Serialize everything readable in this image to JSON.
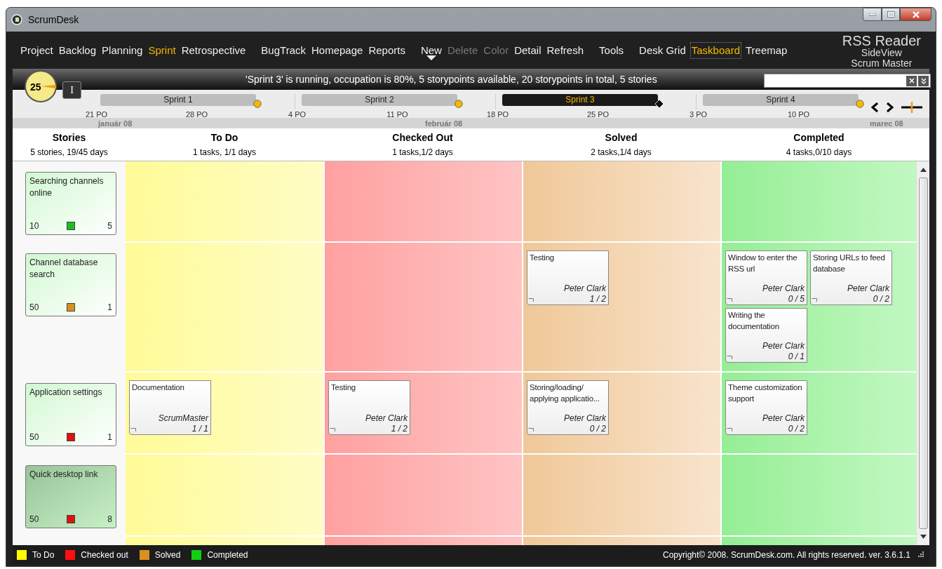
{
  "window": {
    "title": "ScrumDesk"
  },
  "menu": [
    {
      "items": [
        {
          "label": "Project",
          "selected": false,
          "disabled": false
        },
        {
          "label": "Backlog",
          "selected": false,
          "disabled": false
        },
        {
          "label": "Planning",
          "selected": false,
          "disabled": false
        },
        {
          "label": "Sprint",
          "selected": true,
          "disabled": false
        },
        {
          "label": "Retrospective",
          "selected": false,
          "disabled": false
        }
      ]
    },
    {
      "items": [
        {
          "label": "BugTrack",
          "selected": false,
          "disabled": false
        },
        {
          "label": "Homepage",
          "selected": false,
          "disabled": false
        },
        {
          "label": "Reports",
          "selected": false,
          "disabled": false
        }
      ]
    },
    {
      "items": [
        {
          "label": "New",
          "selected": false,
          "disabled": false,
          "has_menu": true
        },
        {
          "label": "Delete",
          "selected": false,
          "disabled": true
        },
        {
          "label": "Color",
          "selected": false,
          "disabled": true
        },
        {
          "label": "Detail",
          "selected": false,
          "disabled": false
        },
        {
          "label": "Refresh",
          "selected": false,
          "disabled": false
        }
      ]
    },
    {
      "items": [
        {
          "label": "Tools",
          "selected": false,
          "disabled": false
        }
      ]
    },
    {
      "items": [
        {
          "label": "Desk Grid",
          "selected": false,
          "disabled": false
        },
        {
          "label": "Taskboard",
          "selected": true,
          "disabled": false
        },
        {
          "label": "Treemap",
          "selected": false,
          "disabled": false
        }
      ]
    }
  ],
  "project": {
    "title": "RSS Reader",
    "lines": [
      "SideView",
      "Scrum Master"
    ]
  },
  "status": {
    "clock": "25",
    "button": "I",
    "message": "'Sprint 3' is running, occupation is 80%, 5 storypoints available, 20 storypoints in total,  5 stories"
  },
  "timeline": {
    "sprints": [
      {
        "label": "Sprint 1",
        "selected": false
      },
      {
        "label": "Sprint 2",
        "selected": false
      },
      {
        "label": "Sprint 3",
        "selected": true
      },
      {
        "label": "Sprint 4",
        "selected": false
      }
    ],
    "dates": [
      "21 PO",
      "28 PO",
      "4 PO",
      "11 PO",
      "18 PO",
      "25 PO",
      "3 PO",
      "10 PO"
    ],
    "months": [
      "január 08",
      "február 08",
      "marec 08"
    ]
  },
  "columns": [
    {
      "kind": "stories",
      "title": "Stories",
      "summary": "5 stories, 19/45 days"
    },
    {
      "kind": "todo",
      "title": "To Do",
      "summary": "1 tasks, 1/1 days"
    },
    {
      "kind": "checked_out",
      "title": "Checked Out",
      "summary": "1 tasks,1/2 days"
    },
    {
      "kind": "solved",
      "title": "Solved",
      "summary": "2 tasks,1/4 days"
    },
    {
      "kind": "completed",
      "title": "Completed",
      "summary": "4 tasks,0/10 days"
    }
  ],
  "stories": [
    {
      "title": "Searching channels online",
      "points": "10",
      "color": "#22bb22",
      "count": "5",
      "selected": false
    },
    {
      "title": "Channel database search",
      "points": "50",
      "color": "#d9901f",
      "count": "1",
      "selected": false,
      "tasks": {
        "solved": [
          {
            "title": "Testing",
            "owner": "Peter Clark",
            "progress": "1 / 2"
          }
        ],
        "completed": [
          {
            "title": "Window to enter the RSS url",
            "owner": "Peter Clark",
            "progress": "0 / 5"
          },
          {
            "title": "Storing URLs to feed database",
            "owner": "Peter Clark",
            "progress": "0 / 2"
          },
          {
            "title": "Writing the documentation",
            "owner": "Peter Clark",
            "progress": "0 / 1"
          }
        ]
      }
    },
    {
      "title": "Application settings",
      "points": "50",
      "color": "#e01010",
      "count": "1",
      "selected": false,
      "tasks": {
        "todo": [
          {
            "title": "Documentation",
            "owner": "ScrumMaster",
            "progress": "1 / 1"
          }
        ],
        "checked_out": [
          {
            "title": "Testing",
            "owner": "Peter Clark",
            "progress": "1 / 2"
          }
        ],
        "solved": [
          {
            "title": "Storing/loading/ applying applicatio...",
            "owner": "Peter Clark",
            "progress": "0 / 2"
          }
        ],
        "completed": [
          {
            "title": "Theme customization support",
            "owner": "Peter Clark",
            "progress": "0 / 2"
          }
        ]
      }
    },
    {
      "title": "Quick desktop link",
      "points": "50",
      "color": "#e01010",
      "count": "8",
      "selected": true
    }
  ],
  "legend": [
    {
      "label": "To Do",
      "color": "#ffff00"
    },
    {
      "label": "Checked out",
      "color": "#ff1010"
    },
    {
      "label": "Solved",
      "color": "#d9901f"
    },
    {
      "label": "Completed",
      "color": "#10d010"
    }
  ],
  "copyright": "Copyright© 2008. ScrumDesk.com. All rights reserved. ver. 3.6.1.1"
}
